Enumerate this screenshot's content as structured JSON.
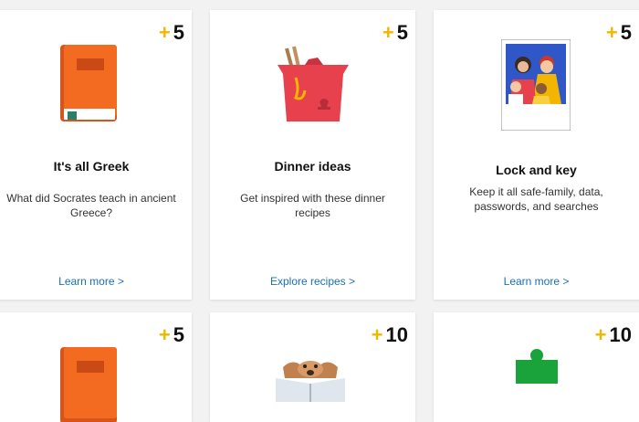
{
  "cards": [
    {
      "points": "5",
      "icon": "greek-book-icon",
      "title": "It's all Greek",
      "description": "What did Socrates teach in ancient Greece?",
      "link": "Learn more >"
    },
    {
      "points": "5",
      "icon": "takeout-box-icon",
      "title": "Dinner ideas",
      "description": "Get inspired with these dinner recipes",
      "link": "Explore recipes >"
    },
    {
      "points": "5",
      "icon": "family-photo-icon",
      "title": "Lock and key",
      "description": "Keep it all safe-family, data, passwords, and searches",
      "link": "Learn more >"
    },
    {
      "points": "5",
      "icon": "greek-book-icon"
    },
    {
      "points": "10",
      "icon": "dog-reading-icon"
    },
    {
      "points": "10",
      "icon": "puzzle-piece-icon"
    }
  ],
  "colors": {
    "accent_plus": "#f2b600",
    "link": "#1a6fb4"
  }
}
